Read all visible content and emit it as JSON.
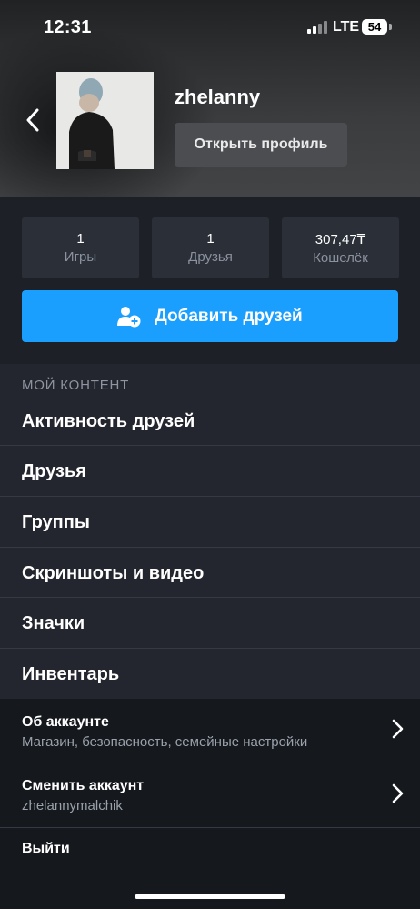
{
  "status_bar": {
    "time": "12:31",
    "network": "LTE",
    "battery": "54"
  },
  "profile": {
    "username": "zhelanny",
    "open_profile_label": "Открыть профиль"
  },
  "stats": [
    {
      "value": "1",
      "label": "Игры"
    },
    {
      "value": "1",
      "label": "Друзья"
    },
    {
      "value": "307,47₸",
      "label": "Кошелёк"
    }
  ],
  "add_friends_label": "Добавить друзей",
  "my_content": {
    "header": "МОЙ КОНТЕНТ",
    "items": [
      {
        "label": "Активность друзей"
      },
      {
        "label": "Друзья"
      },
      {
        "label": "Группы"
      },
      {
        "label": "Скриншоты и видео"
      },
      {
        "label": "Значки"
      },
      {
        "label": "Инвентарь"
      }
    ]
  },
  "account": {
    "title": "Об аккаунте",
    "description": "Магазин, безопасность, семейные настройки"
  },
  "switch_account": {
    "title": "Сменить аккаунт",
    "account_name": "zhelannymalchik"
  },
  "logout_label": "Выйти",
  "colors": {
    "accent": "#1a9fff",
    "background": "#1c1f26"
  },
  "icons": [
    "chevron-left-icon",
    "add-friend-icon",
    "chevron-right-icon",
    "signal-icon",
    "battery-icon"
  ]
}
